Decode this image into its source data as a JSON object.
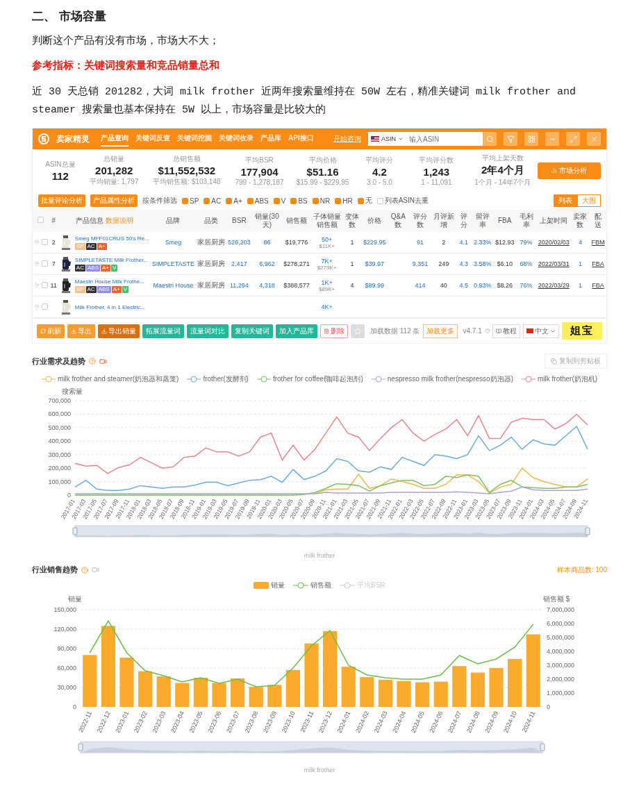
{
  "document": {
    "heading": "二、 市场容量",
    "paragraphs": [
      {
        "kind": "plain",
        "text": "判断这个产品有没有市场，市场大不大；"
      },
      {
        "kind": "highlight",
        "text": "参考指标：关键词搜索量和竞品销量总和"
      },
      {
        "kind": "plain",
        "text": "近 30 天总销 201282，大词 milk frother 近两年搜索量维持在 50W 左右，精准关键词 milk frother and steamer 搜索量也基本保持在 5W 以上，市场容量是比较大的"
      }
    ]
  },
  "app": {
    "logo": "卖家精灵",
    "nav": [
      {
        "label": "产品查询",
        "selected": true
      },
      {
        "label": "关键词反查",
        "selected": false
      },
      {
        "label": "关键词挖掘",
        "selected": false
      },
      {
        "label": "关键词收录",
        "selected": false
      },
      {
        "label": "产品库",
        "selected": false
      },
      {
        "label": "API接口",
        "selected": false
      }
    ],
    "consult_link": "开始咨询",
    "search": {
      "market": "ASIN",
      "placeholder": "输入ASIN"
    },
    "stats": [
      {
        "label": "ASIN总量",
        "value": "112"
      },
      {
        "label": "总销量",
        "value": "201,282",
        "note": "平均销量: 1,797"
      },
      {
        "label": "总销售额",
        "value": "$11,552,532",
        "note": "平均销售额: $103,148"
      },
      {
        "label": "平均BSR",
        "value": "177,904",
        "note": "799 - 1,278,187"
      },
      {
        "label": "平均价格",
        "value": "$51.16",
        "note": "$15.99 - $229.95"
      },
      {
        "label": "平均评分",
        "value": "4.2",
        "note": "3.0 - 5.0"
      },
      {
        "label": "平均评分数",
        "value": "1,243",
        "note": "1 - 11,091"
      },
      {
        "label": "平均上架天数",
        "value": "2年4个月",
        "note": "1个月 - 14年7个月"
      }
    ],
    "market_button": "市场分析",
    "actions": [
      "批量评论分析",
      "产品属性分析"
    ],
    "filter_label": "按条件筛选",
    "filters": [
      {
        "label": "SP",
        "checked": true
      },
      {
        "label": "AC",
        "checked": true
      },
      {
        "label": "A+",
        "checked": true
      },
      {
        "label": "ABS",
        "checked": true
      },
      {
        "label": "V",
        "checked": true
      },
      {
        "label": "BS",
        "checked": true
      },
      {
        "label": "NR",
        "checked": true
      },
      {
        "label": "HR",
        "checked": true
      },
      {
        "label": "无",
        "checked": true
      },
      {
        "label": "列表ASIN去重",
        "checked": false
      }
    ],
    "views": [
      {
        "label": "列表",
        "selected": true
      },
      {
        "label": "大图",
        "selected": false
      }
    ],
    "select_all_checked": false,
    "lead_columns": [
      {
        "label": "#",
        "kind": "rank"
      },
      {
        "label": "产品信息",
        "kind": "product",
        "note": "数据说明"
      },
      {
        "label": "品牌",
        "kind": "brand"
      },
      {
        "label": "品类",
        "kind": "category"
      }
    ],
    "columns": [
      {
        "label": "BSR",
        "kind": "link"
      },
      {
        "label": "销量(30天)",
        "kind": "link"
      },
      {
        "label": "销售额",
        "kind": "plain"
      },
      {
        "label": "子体销量销售额",
        "kind": "stacked"
      },
      {
        "label": "变体数",
        "kind": "plain"
      },
      {
        "label": "价格",
        "kind": "link"
      },
      {
        "label": "Q&A数"
      },
      {
        "label": "评分数",
        "kind": "link"
      },
      {
        "label": "月评新增",
        "kind": "plain"
      },
      {
        "label": "评分",
        "kind": "link"
      },
      {
        "label": "留评率",
        "kind": "link"
      },
      {
        "label": "FBA",
        "kind": "plain"
      },
      {
        "label": "毛利率",
        "kind": "link"
      },
      {
        "label": "上架时间",
        "kind": "date"
      },
      {
        "label": "卖家数",
        "kind": "link"
      },
      {
        "label": "配送",
        "kind": "date"
      }
    ],
    "rows": [
      {
        "checked": false,
        "rank": "2",
        "title": "Smeg MFF01CRUS 50's Re...",
        "tags": [
          {
            "label": "SP",
            "color": "#f5c08a"
          },
          {
            "label": "AC",
            "color": "#333333"
          },
          {
            "label": "A+",
            "color": "#f0642c"
          }
        ],
        "brand": "Smeg",
        "category": "家居厨房",
        "cells": [
          "526,203",
          "86",
          "$19,776",
          [
            "50+",
            "$11K+"
          ],
          "1",
          "$229.95",
          null,
          "91",
          "2",
          "4.1",
          "2.33%",
          "$12.93",
          "79%",
          "2020/02/03",
          "4",
          "FBM"
        ]
      },
      {
        "checked": false,
        "rank": "7",
        "title": "SIMPLETASTE Milk Frother...",
        "tags": [
          {
            "label": "AC",
            "color": "#333333"
          },
          {
            "label": "ABS",
            "color": "#8f8cf2"
          },
          {
            "label": "A+",
            "color": "#f0642c"
          },
          {
            "label": "V",
            "color": "#4cbf6a"
          }
        ],
        "brand": "SIMPLETASTE",
        "category": "家居厨房",
        "cells": [
          "2,417",
          "6,962",
          "$278,271",
          [
            "7K+",
            "$279K+"
          ],
          "1",
          "$39.97",
          null,
          "9,351",
          "249",
          "4.3",
          "3.58%",
          "$6.10",
          "68%",
          "2022/03/31",
          "1",
          "FBA"
        ]
      },
      {
        "checked": false,
        "rank": "11",
        "title": "Maestri House Milk Frothe...",
        "tags": [
          {
            "label": "SP",
            "color": "#f5c08a"
          },
          {
            "label": "AC",
            "color": "#333333"
          },
          {
            "label": "ABS",
            "color": "#8f8cf2"
          },
          {
            "label": "A+",
            "color": "#f0642c"
          },
          {
            "label": "V",
            "color": "#4cbf6a"
          }
        ],
        "brand": "Maestri House",
        "category": "家居厨房",
        "cells": [
          "11,294",
          "4,318",
          "$388,577",
          [
            "1K+",
            "$89K+"
          ],
          "4",
          "$89.99",
          null,
          "414",
          "40",
          "4.5",
          "0.93%",
          "$8.26",
          "76%",
          "2022/03/29",
          "1",
          "FBA"
        ]
      },
      {
        "checked": false,
        "title": "Milk Frother, 4 in 1 Electric...",
        "tags": [],
        "cells": [
          null,
          null,
          null,
          [
            "4K+"
          ]
        ]
      }
    ],
    "toolbar": [
      {
        "kind": "primary",
        "label": "刷新"
      },
      {
        "kind": "primary",
        "label": "导出"
      },
      {
        "kind": "dark",
        "label": "导出销量"
      },
      {
        "kind": "teal",
        "label": "拓展流量词"
      },
      {
        "kind": "teal",
        "label": "流量词对比"
      },
      {
        "kind": "teal",
        "label": "复制关键词"
      },
      {
        "kind": "teal",
        "label": "加入产品库"
      },
      {
        "kind": "danger",
        "label": "删除"
      },
      {
        "kind": "star"
      }
    ],
    "loaded": "加载数据 112 条",
    "load_more": "加载更多",
    "version": "v4.7.1",
    "tutorial": "教程",
    "language": "中文",
    "badge": "姐宝"
  },
  "demand_chart": {
    "title": "行业需求及趋势",
    "copy_button": "复制到剪贴板",
    "slider_label": "milk frother",
    "chart_data": {
      "type": "line",
      "legend": "top",
      "grid": true,
      "ylabel": "搜索量",
      "ylim": [
        0,
        700000
      ],
      "yticks": [
        0,
        {
          "value": 100000,
          "label": "100,000"
        },
        {
          "value": 200000,
          "label": "200,000"
        },
        {
          "value": 300000,
          "label": "300,000"
        },
        {
          "value": 400000,
          "label": "400,000"
        },
        {
          "value": 500000,
          "label": "500,000"
        },
        {
          "value": 600000,
          "label": "600,000"
        },
        {
          "value": 700000,
          "label": "700,000"
        }
      ],
      "x": [
        "2017-01",
        "2017-03",
        "2017-05",
        "2017-07",
        "2017-09",
        "2017-11",
        "2018-01",
        "2018-03",
        "2018-05",
        "2018-07",
        "2018-09",
        "2018-11",
        "2019-01",
        "2019-03",
        "2019-05",
        "2019-07",
        "2019-09",
        "2019-11",
        "2020-01",
        "2020-03",
        "2020-05",
        "2020-07",
        "2020-09",
        "2020-11",
        "2021-01",
        "2021-03",
        "2021-05",
        "2021-07",
        "2021-09",
        "2021-11",
        "2022-01",
        "2022-03",
        "2022-05",
        "2022-07",
        "2022-09",
        "2022-11",
        "2023-01",
        "2023-03",
        "2023-05",
        "2023-07",
        "2023-09",
        "2023-11",
        "2024-01",
        "2024-03",
        "2024-05",
        "2024-07",
        "2024-09",
        "2024-11"
      ],
      "series": [
        {
          "name": "milk frother and steamer(奶泡器和蒸笼)",
          "color": "#f2b84b",
          "values": [
            null,
            null,
            null,
            null,
            null,
            null,
            null,
            null,
            null,
            null,
            null,
            null,
            null,
            null,
            null,
            null,
            null,
            null,
            null,
            null,
            null,
            null,
            10000,
            40000,
            45000,
            45000,
            155000,
            50000,
            70000,
            120000,
            100000,
            80000,
            50000,
            50000,
            80000,
            150000,
            150000,
            100000,
            15000,
            60000,
            80000,
            200000,
            130000,
            100000,
            80000,
            60000,
            60000,
            120000
          ]
        },
        {
          "name": "frother(发酵剂)",
          "color": "#6aaed8",
          "values": [
            60000,
            110000,
            45000,
            35000,
            35000,
            45000,
            70000,
            60000,
            50000,
            60000,
            60000,
            75000,
            95000,
            95000,
            70000,
            90000,
            110000,
            115000,
            140000,
            95000,
            190000,
            115000,
            140000,
            180000,
            270000,
            250000,
            180000,
            170000,
            210000,
            190000,
            280000,
            250000,
            220000,
            300000,
            290000,
            270000,
            300000,
            440000,
            330000,
            370000,
            430000,
            340000,
            410000,
            380000,
            370000,
            440000,
            510000,
            340000
          ]
        },
        {
          "name": "frother for coffee(咖啡起泡剂)",
          "color": "#7cc35e",
          "values": [
            0,
            0,
            0,
            0,
            0,
            0,
            0,
            0,
            0,
            0,
            0,
            0,
            0,
            0,
            0,
            0,
            0,
            0,
            0,
            0,
            0,
            5000,
            20000,
            50000,
            85000,
            80000,
            70000,
            30000,
            70000,
            90000,
            110000,
            110000,
            70000,
            80000,
            140000,
            130000,
            150000,
            140000,
            20000,
            80000,
            110000,
            60000,
            55000,
            50000,
            50000,
            60000,
            60000,
            80000
          ]
        },
        {
          "name": "nespresso milk frother(nespresso奶泡器)",
          "color": "#a9a3d6",
          "values": [
            10000,
            10000,
            10000,
            10000,
            10000,
            10000,
            10000,
            10000,
            10000,
            10000,
            10000,
            10000,
            10000,
            10000,
            10000,
            10000,
            10000,
            10000,
            10000,
            10000,
            10000,
            10000,
            10000,
            20000,
            15000,
            15000,
            15000,
            15000,
            15000,
            20000,
            20000,
            20000,
            20000,
            20000,
            20000,
            25000,
            20000,
            15000,
            10000,
            20000,
            30000,
            60000,
            40000,
            35000,
            35000,
            35000,
            35000,
            45000
          ]
        },
        {
          "name": "milk frother(奶泡机)",
          "color": "#e8868e",
          "values": [
            235000,
            215000,
            220000,
            160000,
            205000,
            225000,
            280000,
            240000,
            200000,
            210000,
            280000,
            290000,
            350000,
            320000,
            320000,
            290000,
            320000,
            430000,
            460000,
            260000,
            370000,
            260000,
            340000,
            460000,
            580000,
            460000,
            430000,
            330000,
            420000,
            500000,
            560000,
            460000,
            400000,
            450000,
            490000,
            560000,
            440000,
            590000,
            420000,
            420000,
            540000,
            570000,
            560000,
            560000,
            490000,
            530000,
            600000,
            520000
          ]
        }
      ]
    }
  },
  "sales_chart": {
    "title": "行业销售趋势",
    "sample_count": "样本商品数: 100",
    "slider_label": "milk frother",
    "extra_legend": [
      {
        "label": "平均BSR",
        "selected": false
      }
    ],
    "chart_data": {
      "type": "bar",
      "legend": "top",
      "grid": true,
      "ylabel": "销量",
      "y2label": "销售额 $",
      "ylim": [
        0,
        150000
      ],
      "yticks": [
        0,
        {
          "value": 30000,
          "label": "30,000"
        },
        {
          "value": 60000,
          "label": "60,000"
        },
        {
          "value": 90000,
          "label": "90,000"
        },
        {
          "value": 120000,
          "label": "120,000"
        },
        {
          "value": 150000,
          "label": "150,000"
        }
      ],
      "y2lim": [
        0,
        7000000
      ],
      "y2ticks": [
        0,
        {
          "value": 1000000,
          "label": "1,000,000"
        },
        {
          "value": 2000000,
          "label": "2,000,000"
        },
        {
          "value": 3000000,
          "label": "3,000,000"
        },
        {
          "value": 4000000,
          "label": "4,000,000"
        },
        {
          "value": 5000000,
          "label": "5,000,000"
        },
        {
          "value": 6000000,
          "label": "6,000,000"
        },
        {
          "value": 7000000,
          "label": "7,000,000"
        }
      ],
      "categories": [
        "2022-11",
        "2022-12",
        "2023-01",
        "2023-02",
        "2023-03",
        "2023-04",
        "2023-05",
        "2023-06",
        "2023-07",
        "2023-08",
        "2023-09",
        "2023-10",
        "2023-11",
        "2023-12",
        "2024-01",
        "2024-02",
        "2024-03",
        "2024-04",
        "2024-05",
        "2024-06",
        "2024-07",
        "2024-08",
        "2024-09",
        "2024-10",
        "2024-11"
      ],
      "series": [
        {
          "name": "销量",
          "color": "#fbab2c",
          "values": [
            80000,
            125000,
            76000,
            55000,
            47000,
            37000,
            45000,
            37000,
            44000,
            31000,
            34000,
            57000,
            98000,
            117000,
            62000,
            46000,
            42000,
            40000,
            38000,
            39000,
            63000,
            53000,
            60000,
            74000,
            112000
          ]
        },
        {
          "name": "销售额",
          "type": "line",
          "axis": "y2",
          "color": "#6cbf4a",
          "values": [
            3900000,
            6200000,
            3900000,
            2600000,
            2250000,
            1800000,
            2100000,
            1700000,
            2000000,
            1450000,
            1550000,
            2800000,
            4400000,
            5500000,
            3000000,
            2300000,
            2100000,
            2000000,
            2000000,
            2300000,
            3700000,
            3100000,
            3450000,
            4300000,
            5950000
          ]
        }
      ]
    }
  }
}
